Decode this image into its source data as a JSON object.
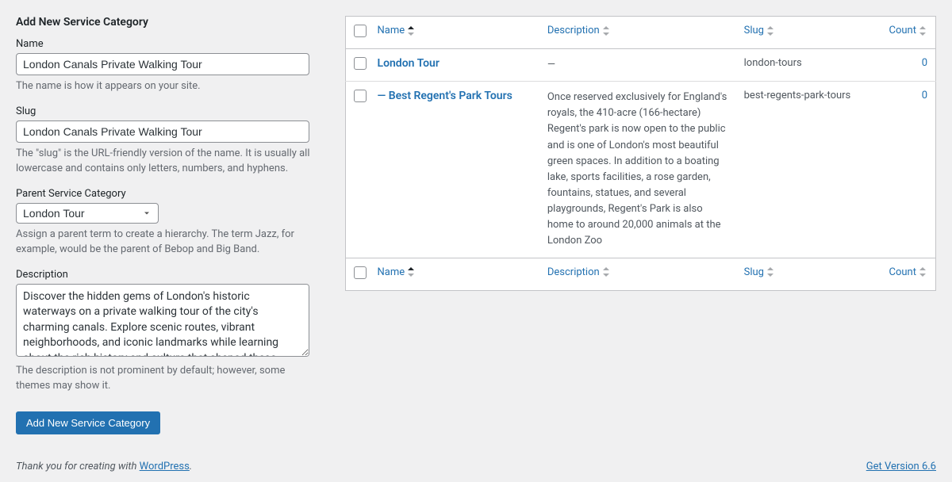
{
  "form": {
    "heading": "Add New Service Category",
    "name_label": "Name",
    "name_value": "London Canals Private Walking Tour",
    "name_help": "The name is how it appears on your site.",
    "slug_label": "Slug",
    "slug_value": "London Canals Private Walking Tour",
    "slug_help": "The \"slug\" is the URL-friendly version of the name. It is usually all lowercase and contains only letters, numbers, and hyphens.",
    "parent_label": "Parent Service Category",
    "parent_selected": "London Tour",
    "parent_help": "Assign a parent term to create a hierarchy. The term Jazz, for example, would be the parent of Bebop and Big Band.",
    "desc_label": "Description",
    "desc_value": "Discover the hidden gems of London's historic waterways on a private walking tour of the city's charming canals. Explore scenic routes, vibrant neighborhoods, and iconic landmarks while learning about the rich history and culture that shaped these unique urban landscapes. Perfect for those seeking a",
    "desc_help": "The description is not prominent by default; however, some themes may show it.",
    "submit": "Add New Service Category"
  },
  "table": {
    "headers": {
      "name": "Name",
      "description": "Description",
      "slug": "Slug",
      "count": "Count"
    },
    "rows": [
      {
        "name": "London Tour",
        "description": "—",
        "slug": "london-tours",
        "count": "0"
      },
      {
        "name": "— Best Regent's Park Tours",
        "description": "Once reserved exclusively for England's royals, the 410-acre (166-hectare) Regent's park is now open to the public and is one of London's most beautiful green spaces. In addition to a boating lake, sports facilities, a rose garden, fountains, statues, and several playgrounds, Regent's Park is also home to around 20,000 animals at the London Zoo",
        "slug": "best-regents-park-tours",
        "count": "0"
      }
    ]
  },
  "footer": {
    "thanks_prefix": "Thank you for creating with ",
    "thanks_link": "WordPress",
    "thanks_suffix": ".",
    "version": "Get Version 6.6"
  }
}
